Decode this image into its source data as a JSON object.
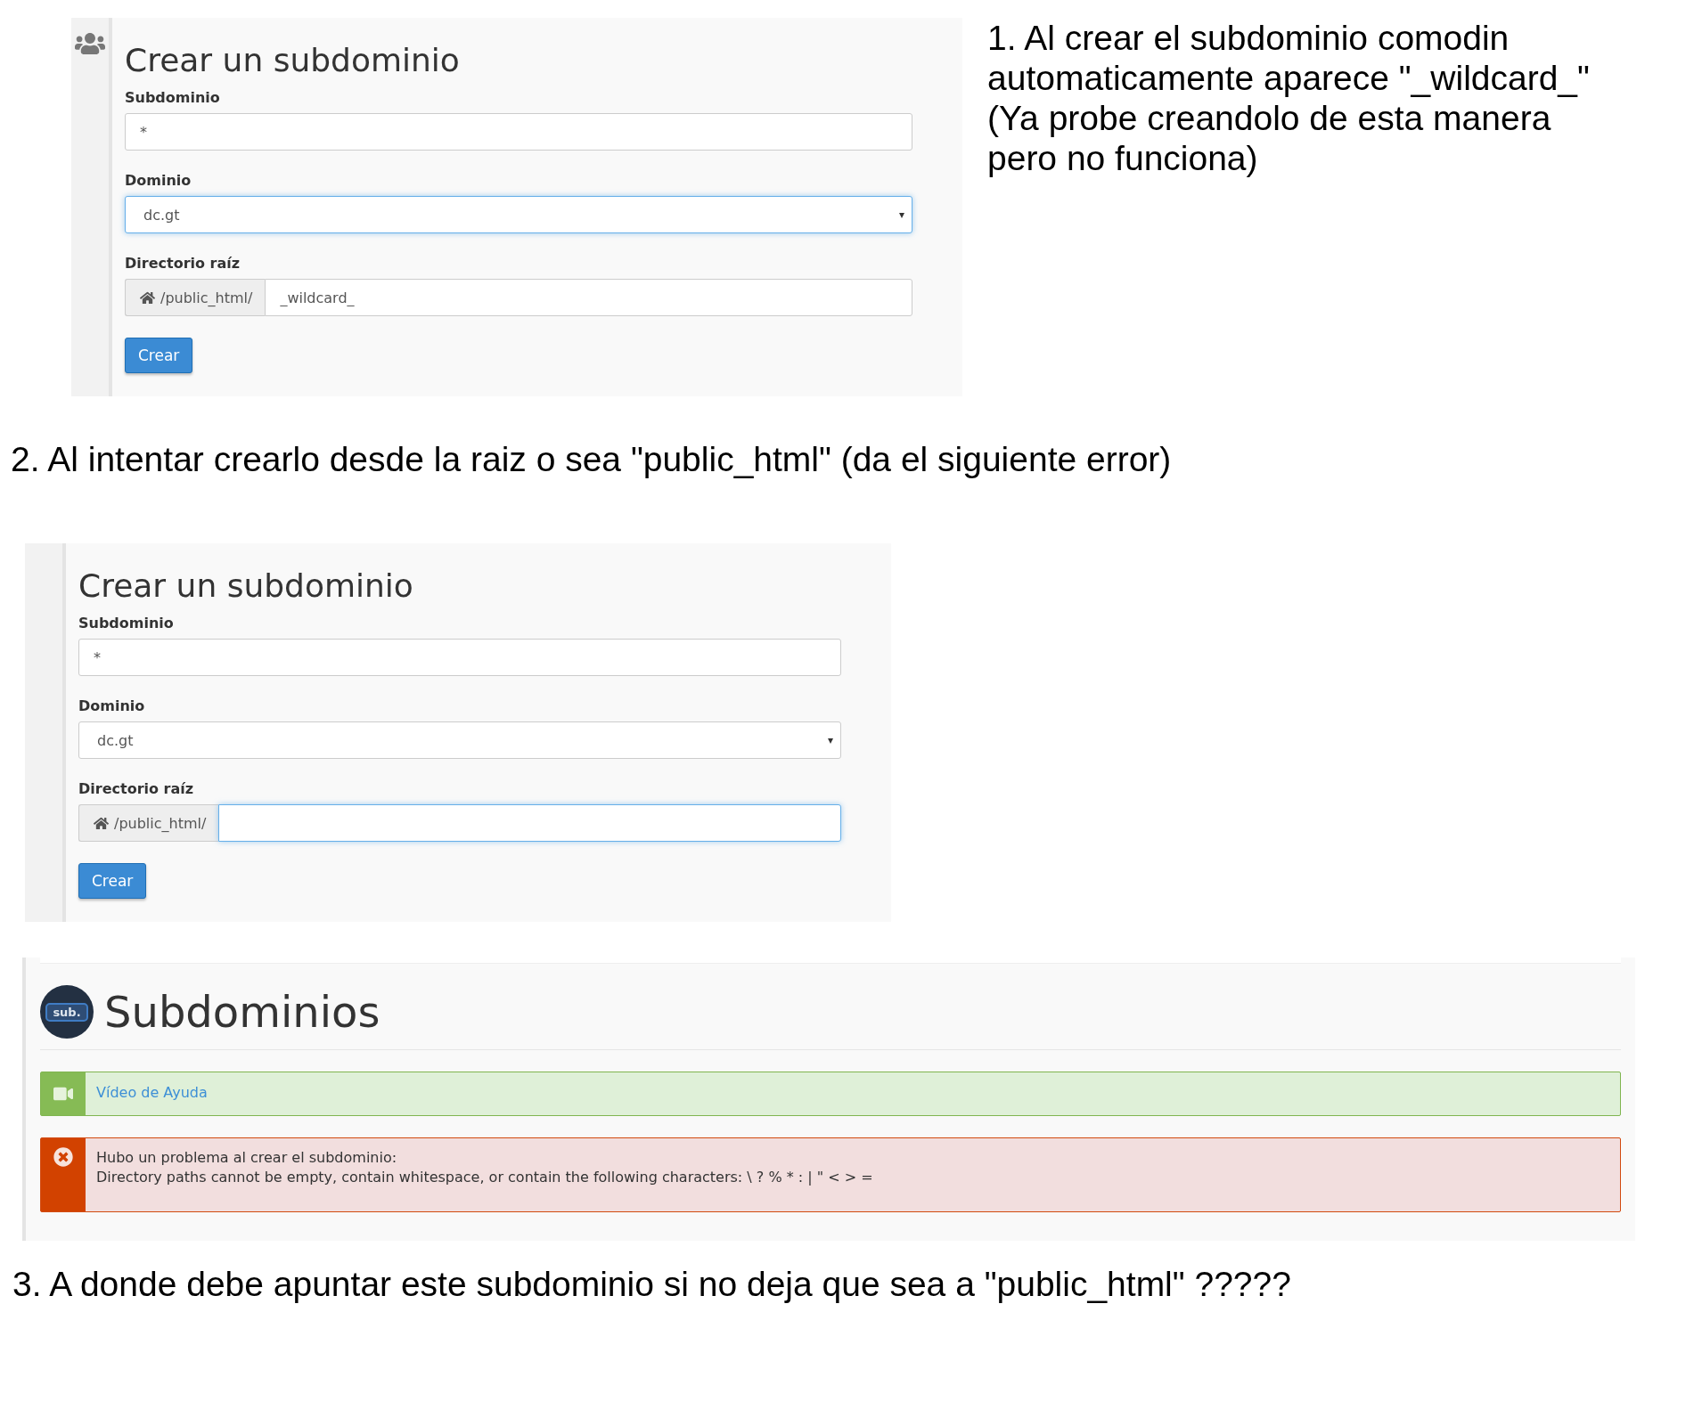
{
  "form_1": {
    "show_side_icon": true,
    "title": "Crear un subdominio",
    "fields": [
      {
        "kind": "text",
        "label": "Subdominio",
        "value": "*",
        "focused": false
      },
      {
        "kind": "select",
        "label": "Dominio",
        "value": "dc.gt",
        "caret": "▾",
        "focused": true
      },
      {
        "kind": "path",
        "label": "Directorio raíz",
        "prefix": "/public_html/",
        "value": "_wildcard_",
        "focused": false
      }
    ],
    "button": "Crear"
  },
  "note_1": "1. Al crear el subdominio comodin automaticamente aparece \"_wildcard_\" (Ya probe creandolo de esta manera pero no funciona)",
  "note_2": "2. Al intentar crearlo desde la raiz o sea \"public_html\" (da el siguiente error)",
  "form_2": {
    "show_side_icon": false,
    "title": "Crear un subdominio",
    "fields": [
      {
        "kind": "text",
        "label": "Subdominio",
        "value": "*",
        "focused": false
      },
      {
        "kind": "select",
        "label": "Dominio",
        "value": "dc.gt",
        "caret": "▾",
        "focused": false
      },
      {
        "kind": "path",
        "label": "Directorio raíz",
        "prefix": "/public_html/",
        "focused": true
      }
    ],
    "button": "Crear"
  },
  "subdomains_panel": {
    "logo_text": "sub.",
    "title": "Subdominios",
    "alerts": [
      {
        "kind": "help",
        "lines": [
          "Vídeo de Ayuda"
        ]
      },
      {
        "kind": "error",
        "lines": [
          "Hubo un problema al crear el subdominio:",
          "Directory paths cannot be empty, contain whitespace, or contain the following characters: \\ ? % * : | \" < > ="
        ]
      }
    ]
  },
  "note_3": "3. A donde debe apuntar este subdominio si no deja que sea a \"public_html\" ?????"
}
